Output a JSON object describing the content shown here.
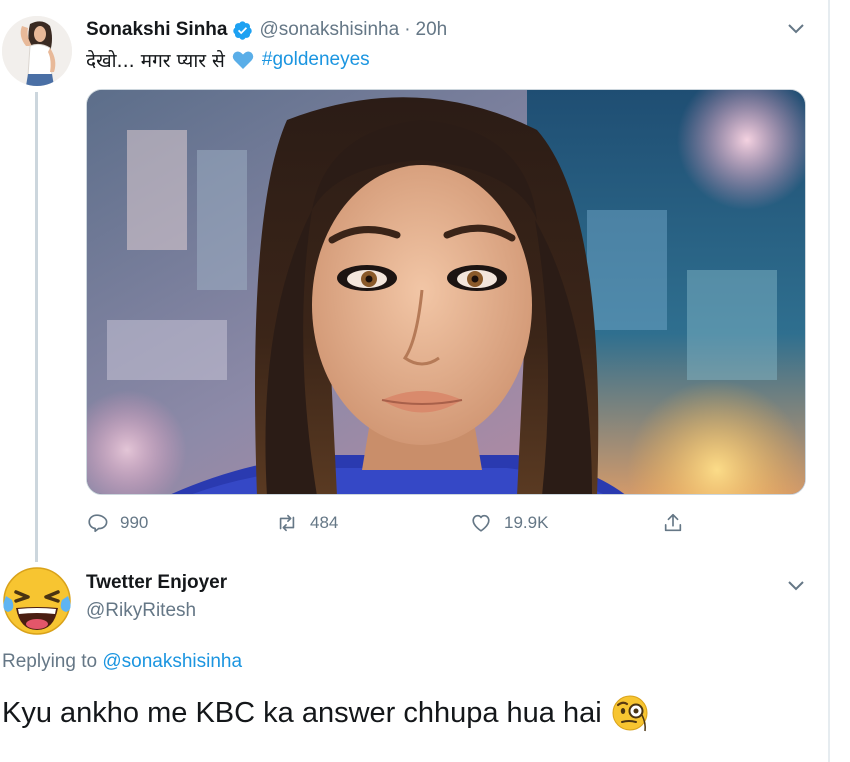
{
  "tweet": {
    "author_name": "Sonakshi Sinha",
    "author_handle": "@sonakshisinha",
    "separator": "·",
    "time_ago": "20h",
    "text_prefix": "देखो... मगर प्यार से",
    "hashtag": "#goldeneyes",
    "verified_icon": "verified-badge-icon",
    "heart_emoji": "blue-heart",
    "stats": {
      "replies": "990",
      "retweets": "484",
      "likes": "19.9K"
    }
  },
  "reply": {
    "author_name": "Twetter Enjoyer",
    "author_handle": "@RikyRitesh",
    "replying_label": "Replying to",
    "replying_to": "@sonakshisinha",
    "text": "Kyu ankho me KBC ka answer chhupa hua hai",
    "emoji": "face-with-monocle"
  },
  "colors": {
    "link": "#1b95e0",
    "secondary_text": "#657786",
    "primary_text": "#14171a",
    "verified": "#1da1f2",
    "thread_line": "#ccd6dd"
  }
}
